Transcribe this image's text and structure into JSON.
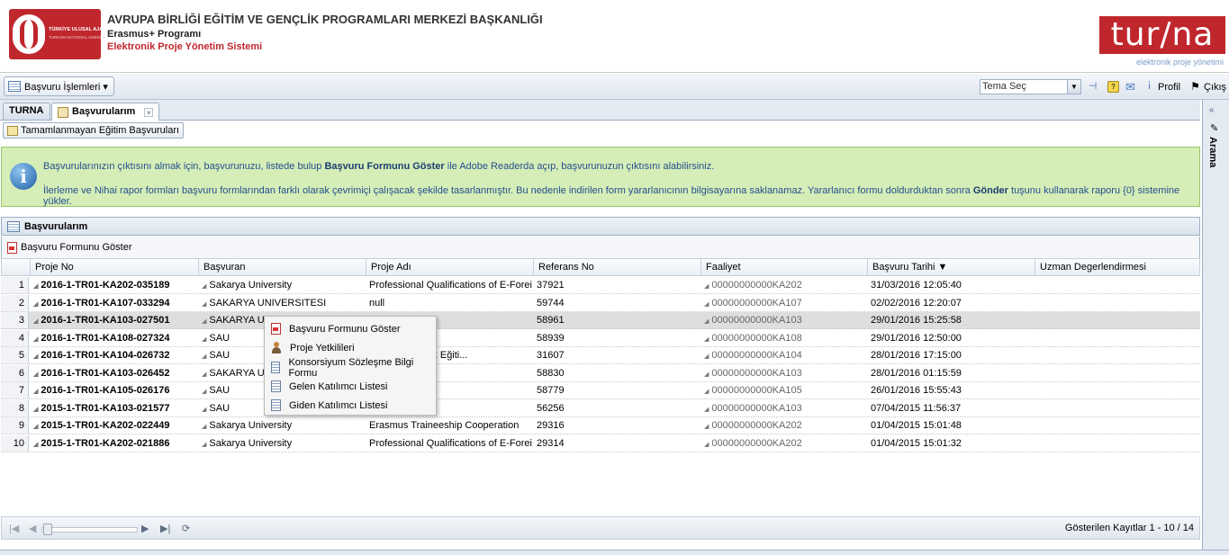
{
  "header": {
    "logo_text_1": "TÜRKİYE ULUSAL AJANSI",
    "logo_text_2": "TURKISH NATIONAL AGENCY",
    "title": "AVRUPA BİRLİĞİ EĞİTİM VE GENÇLİK PROGRAMLARI MERKEZİ BAŞKANLIĞI",
    "program": "Erasmus+ Programı",
    "system": "Elektronik Proje Yönetim Sistemi",
    "brand": "tur/na",
    "brand_sub": "elektronik proje yönetimi"
  },
  "toolbar": {
    "menu_label": "Başvuru İşlemleri ▾",
    "theme_placeholder": "Tema Seç",
    "profile_label": "Profil",
    "logout_label": "Çıkış"
  },
  "tabs": [
    {
      "label": "TURNA"
    },
    {
      "label": "Başvurularım"
    }
  ],
  "right_rail": {
    "label": "Arama",
    "collapse": "«"
  },
  "sub_toolbar": {
    "button_label": "Tamamlanmayan Eğitim Başvuruları"
  },
  "info": {
    "l1_a": "Başvurularınızın çıktısını almak için, başvurunuzu, listede bulup ",
    "l1_b": "Başvuru Formunu Göster",
    "l1_c": " ile Adobe Readerda açıp, başvurunuzun çıktısını alabilirsiniz.",
    "l2_a": "İlerleme ve Nihai rapor formları başvuru formlarından farklı olarak çevrimiçi çalışacak şekilde tasarlanmıştır. Bu nedenle indirilen form yararlanıcının bilgisayarına saklanamaz. Yararlanıcı formu doldurduktan sonra ",
    "l2_b": "Gönder",
    "l2_c": " tuşunu kullanarak raporu {0} sistemine yükler."
  },
  "grid": {
    "title": "Başvurularım",
    "toolbar_button": "Başvuru Formunu Göster",
    "columns": [
      "Proje No",
      "Başvuran",
      "Proje Adı",
      "Referans No",
      "Faaliyet",
      "Başvuru Tarihi ▼",
      "Uzman Degerlendirmesi"
    ],
    "rows": [
      {
        "n": "1",
        "proje_no": "2016-1-TR01-KA202-035189",
        "basvuran": "Sakarya University",
        "proje_adi": "Professional Qualifications of E-Foreig...",
        "ref": "37921",
        "faaliyet": "00000000000KA202",
        "tarih": "31/03/2016 12:05:40"
      },
      {
        "n": "2",
        "proje_no": "2016-1-TR01-KA107-033294",
        "basvuran": "SAKARYA UNIVERSITESI",
        "proje_adi": "null",
        "ref": "59744",
        "faaliyet": "00000000000KA107",
        "tarih": "02/02/2016 12:20:07"
      },
      {
        "n": "3",
        "proje_no": "2016-1-TR01-KA103-027501",
        "basvuran": "SAKARYA UNI",
        "proje_adi": "",
        "ref": "58961",
        "faaliyet": "00000000000KA103",
        "tarih": "29/01/2016 15:25:58"
      },
      {
        "n": "4",
        "proje_no": "2016-1-TR01-KA108-027324",
        "basvuran": "SAU",
        "proje_adi": "",
        "ref": "58939",
        "faaliyet": "00000000000KA108",
        "tarih": "29/01/2016 12:50:00"
      },
      {
        "n": "5",
        "proje_no": "2016-1-TR01-KA104-026732",
        "basvuran": "SAU",
        "proje_adi": "lmanca Hazırlık Eğiti...",
        "ref": "31607",
        "faaliyet": "00000000000KA104",
        "tarih": "28/01/2016 17:15:00"
      },
      {
        "n": "6",
        "proje_no": "2016-1-TR01-KA103-026452",
        "basvuran": "SAKARYA UNI",
        "proje_adi": "",
        "ref": "58830",
        "faaliyet": "00000000000KA103",
        "tarih": "28/01/2016 01:15:59"
      },
      {
        "n": "7",
        "proje_no": "2016-1-TR01-KA105-026176",
        "basvuran": "SAU",
        "proje_adi": "",
        "ref": "58779",
        "faaliyet": "00000000000KA105",
        "tarih": "26/01/2016 15:55:43"
      },
      {
        "n": "8",
        "proje_no": "2015-1-TR01-KA103-021577",
        "basvuran": "SAU",
        "proje_adi": "",
        "ref": "56256",
        "faaliyet": "00000000000KA103",
        "tarih": "07/04/2015 11:56:37"
      },
      {
        "n": "9",
        "proje_no": "2015-1-TR01-KA202-022449",
        "basvuran": "Sakarya University",
        "proje_adi": "Erasmus Traineeship Cooperation",
        "ref": "29316",
        "faaliyet": "00000000000KA202",
        "tarih": "01/04/2015 15:01:48"
      },
      {
        "n": "10",
        "proje_no": "2015-1-TR01-KA202-021886",
        "basvuran": "Sakarya University",
        "proje_adi": "Professional Qualifications of E-Foreig...",
        "ref": "29314",
        "faaliyet": "00000000000KA202",
        "tarih": "01/04/2015 15:01:32"
      }
    ],
    "selected_row": 3
  },
  "context_menu": [
    {
      "label": "Başvuru Formunu Göster",
      "icon": "pdf-icon"
    },
    {
      "label": "Proje Yetkilileri",
      "icon": "person-icon"
    },
    {
      "label": "Konsorsiyum Sözleşme Bilgi Formu",
      "icon": "form-icon"
    },
    {
      "label": "Gelen Katılımcı Listesi",
      "icon": "form-icon"
    },
    {
      "label": "Giden Katılımcı Listesi",
      "icon": "form-icon"
    }
  ],
  "paging": {
    "info": "Gösterilen Kayıtlar 1 - 10 / 14"
  }
}
